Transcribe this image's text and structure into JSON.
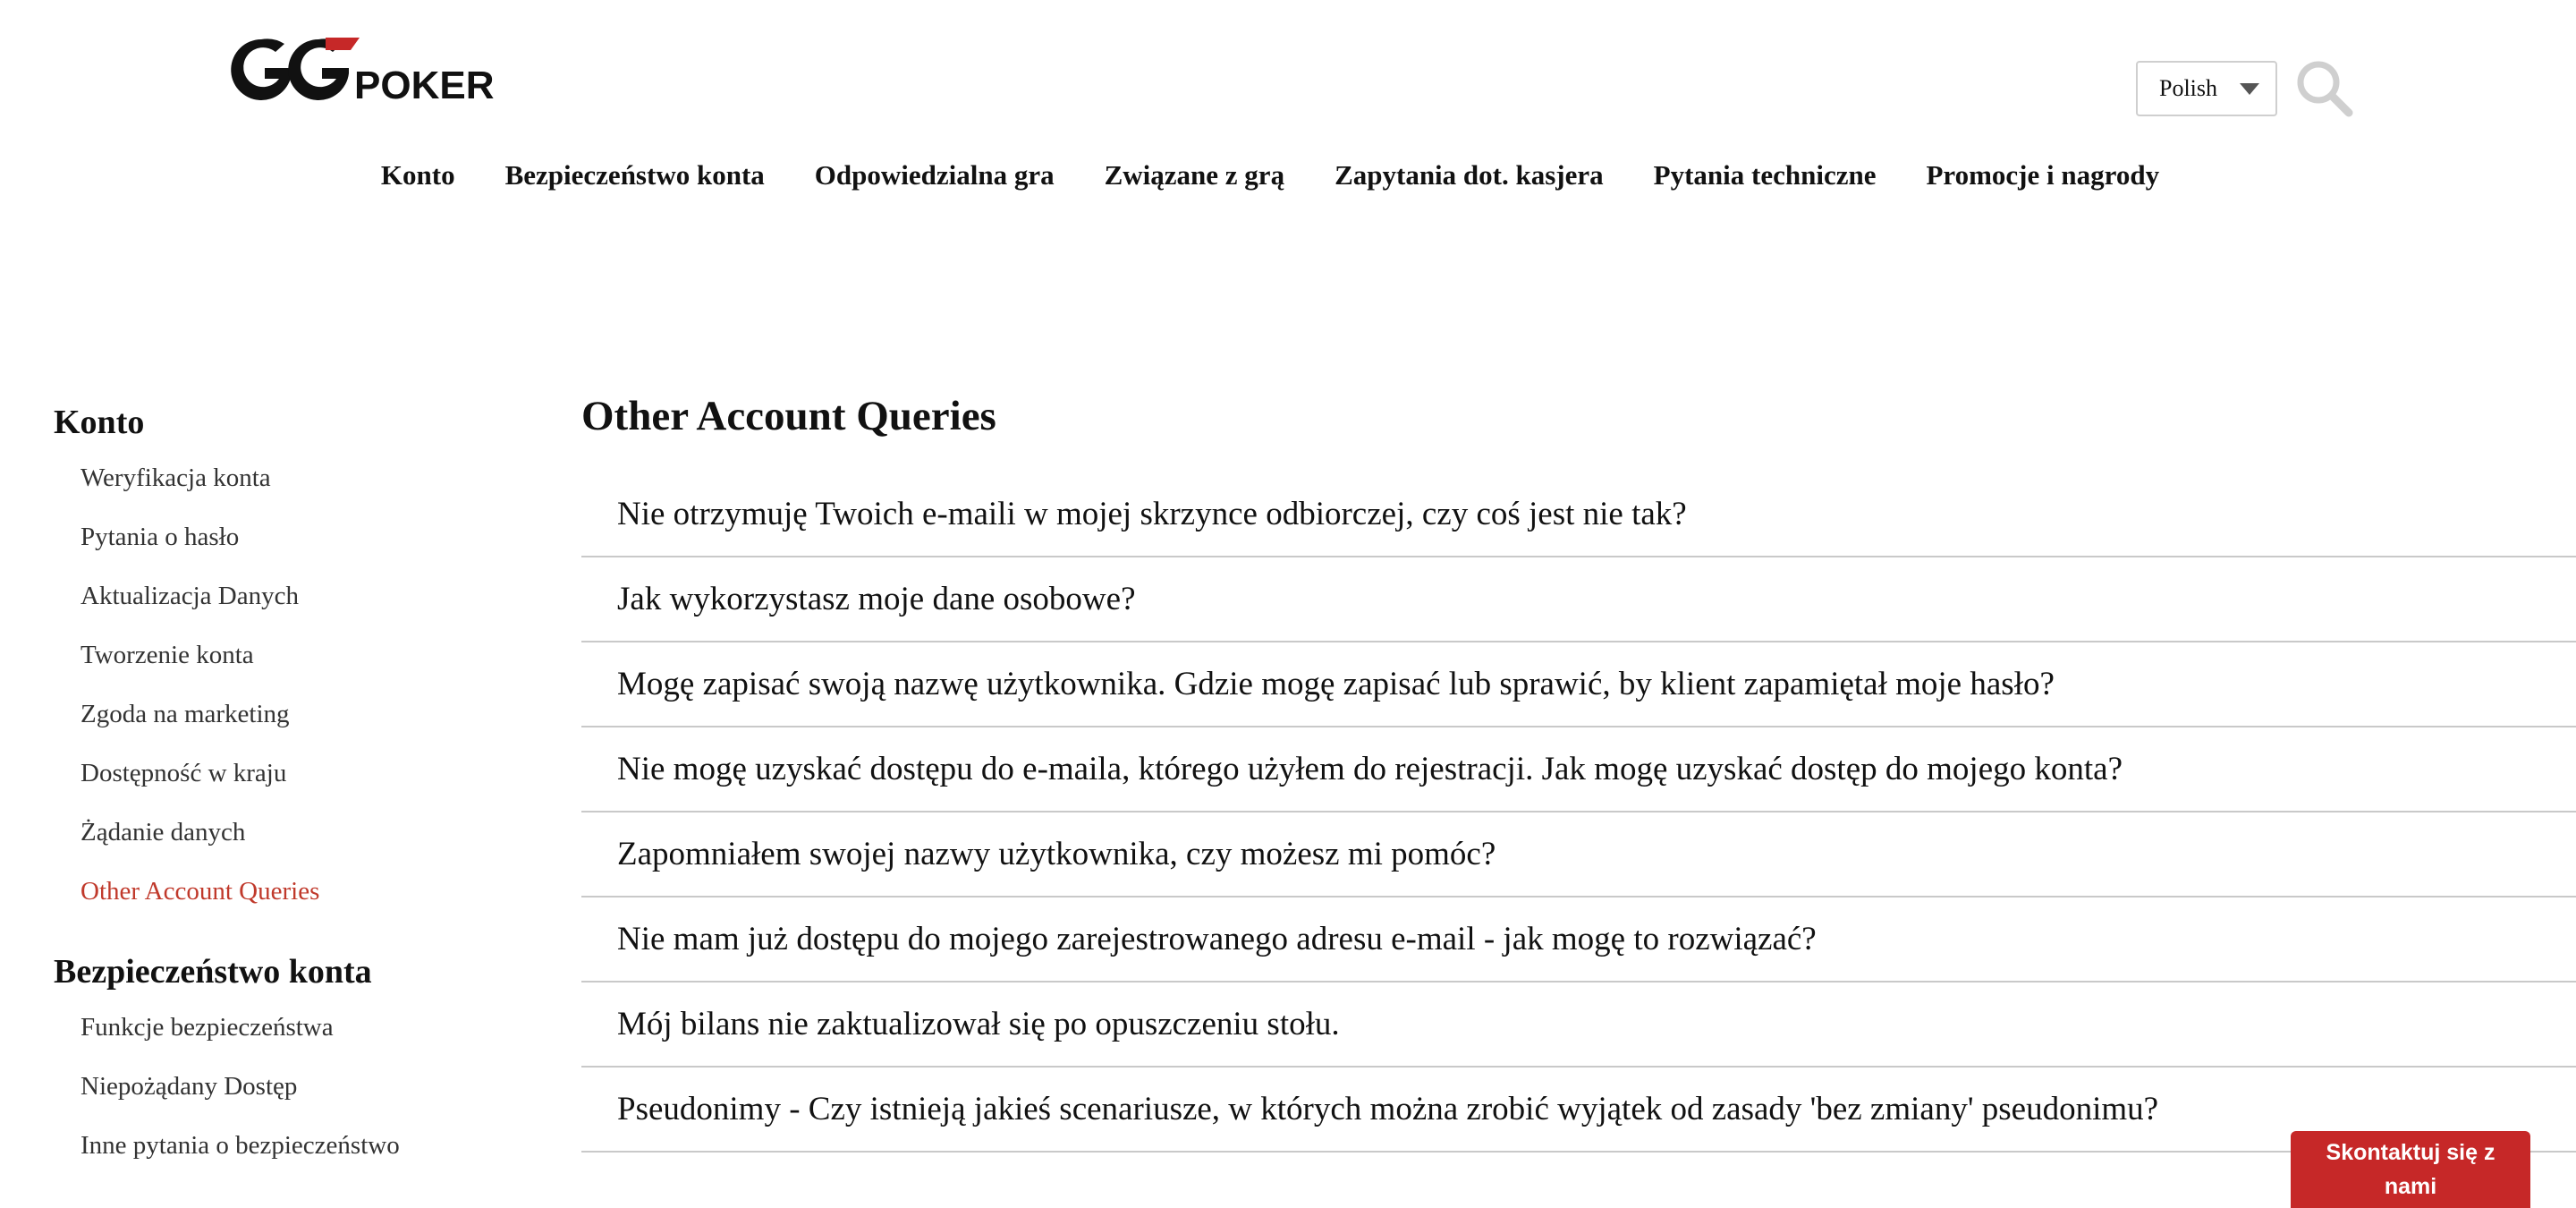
{
  "header": {
    "logo_text": "GGPOKER",
    "language": {
      "selected": "Polish"
    },
    "nav": [
      "Konto",
      "Bezpieczeństwo konta",
      "Odpowiedzialna gra",
      "Związane z grą",
      "Zapytania dot. kasjera",
      "Pytania techniczne",
      "Promocje i nagrody"
    ]
  },
  "sidebar": {
    "groups": [
      {
        "title": "Konto",
        "items": [
          "Weryfikacja konta",
          "Pytania o hasło",
          "Aktualizacja Danych",
          "Tworzenie konta",
          "Zgoda na marketing",
          "Dostępność w kraju",
          "Żądanie danych",
          "Other Account Queries"
        ],
        "active_index": 7
      },
      {
        "title": "Bezpieczeństwo konta",
        "items": [
          "Funkcje bezpieczeństwa",
          "Niepożądany Dostęp",
          "Inne pytania o bezpieczeństwo"
        ]
      }
    ]
  },
  "main": {
    "title": "Other Account Queries",
    "faqs": [
      "Nie otrzymuję Twoich e-maili w mojej skrzynce odbiorczej, czy coś jest nie tak?",
      "Jak wykorzystasz moje dane osobowe?",
      "Mogę zapisać swoją nazwę użytkownika. Gdzie mogę zapisać lub sprawić, by klient zapamiętał moje hasło?",
      "Nie mogę uzyskać dostępu do e-maila, którego użyłem do rejestracji. Jak mogę uzyskać dostęp do mojego konta?",
      "Zapomniałem swojej nazwy użytkownika, czy możesz mi pomóc?",
      "Nie mam już dostępu do mojego zarejestrowanego adresu e-mail - jak mogę to rozwiązać?",
      "Mój bilans nie zaktualizował się po opuszczeniu stołu.",
      "Pseudonimy - Czy istnieją jakieś scenariusze, w których można zrobić wyjątek od zasady 'bez zmiany' pseudonimu?"
    ]
  },
  "contact_button": {
    "label": "Skontaktuj się z nami"
  },
  "colors": {
    "accent": "#c0392b",
    "button": "#c62828",
    "divider": "#c9c9c9"
  }
}
